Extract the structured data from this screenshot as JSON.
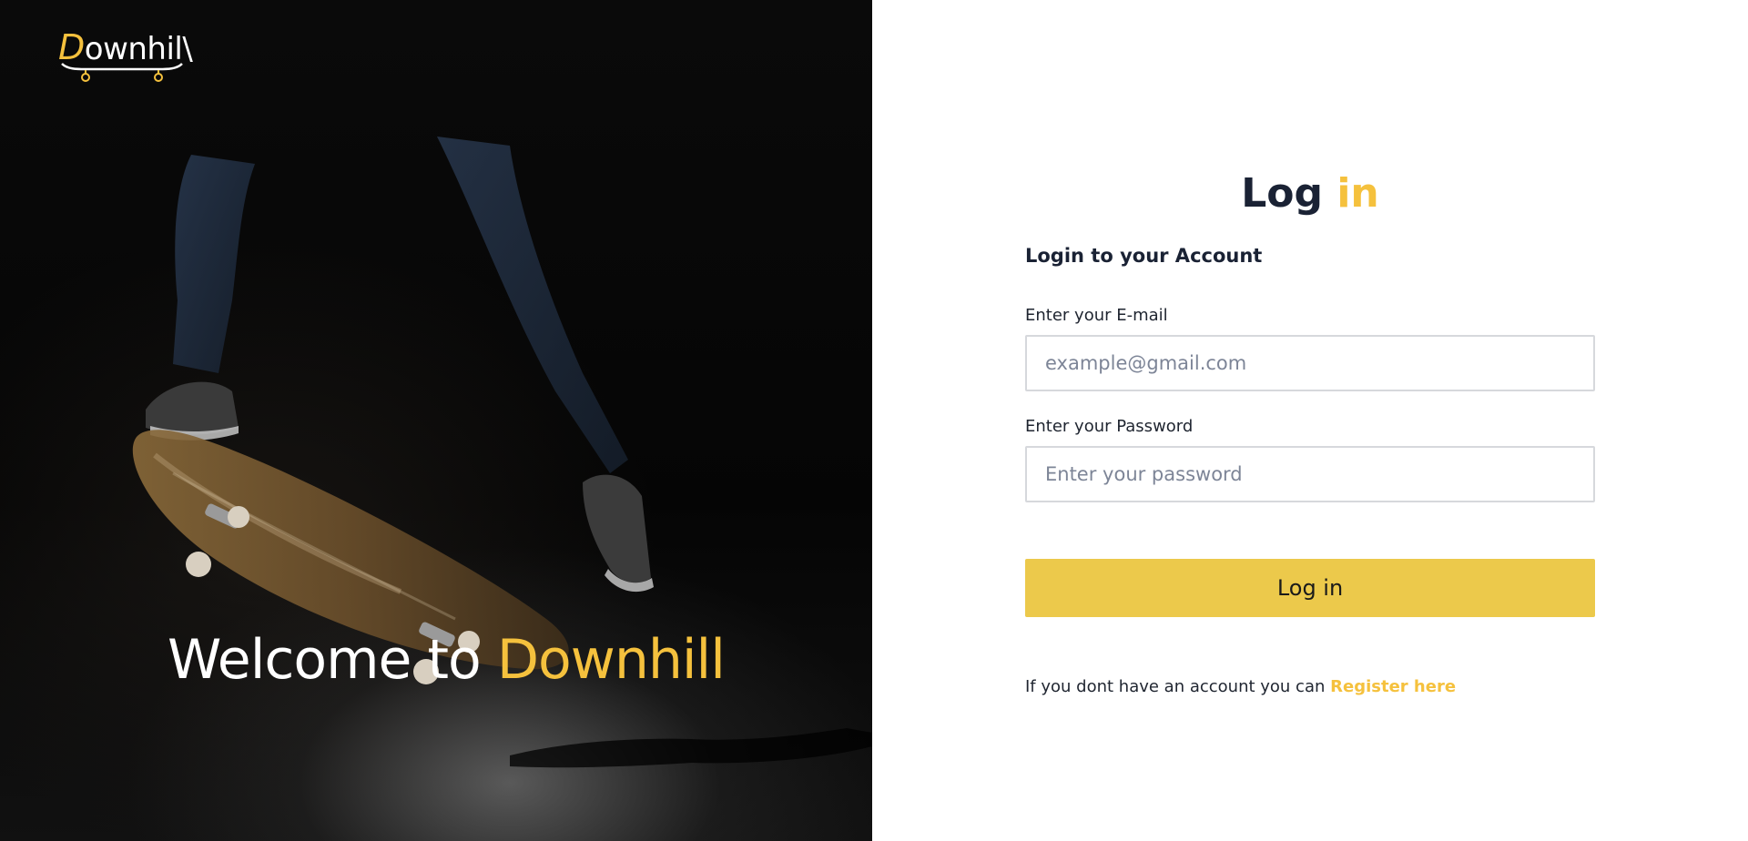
{
  "brand": {
    "logo_first_letter": "D",
    "logo_rest": "ownhil\\"
  },
  "hero": {
    "welcome_prefix": "Welcome to ",
    "welcome_accent": "Downhill"
  },
  "login": {
    "title_main": "Log",
    "title_accent": "in",
    "subtitle": "Login to your Account",
    "email_label": "Enter your E-mail",
    "email_placeholder": "example@gmail.com",
    "password_label": "Enter your Password",
    "password_placeholder": "Enter your password",
    "submit_label": "Log in",
    "register_prompt": "If you dont have an account you can",
    "register_link": "Register here"
  },
  "colors": {
    "accent": "#f5c13d",
    "button": "#ecc94b",
    "text_dark": "#1a2234",
    "hero_bg": "#050505"
  }
}
